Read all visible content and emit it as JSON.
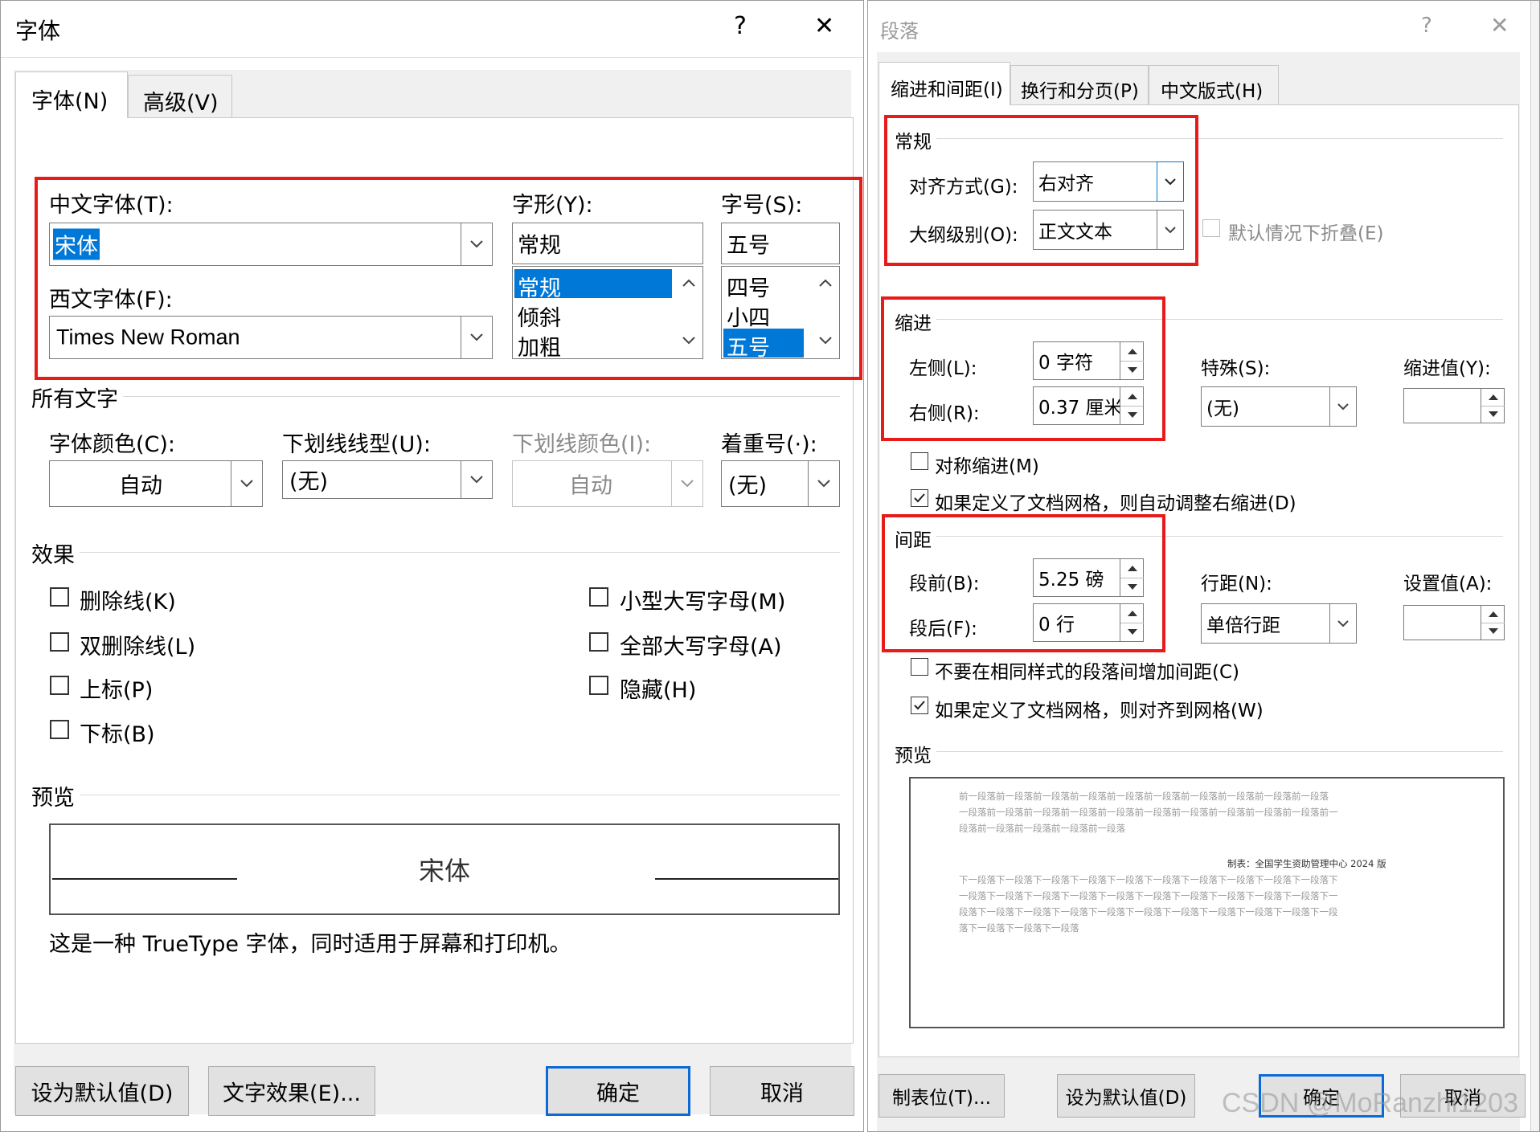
{
  "font_dialog": {
    "title": "字体",
    "help": "?",
    "close": "✕",
    "tabs": [
      "字体(N)",
      "高级(V)"
    ],
    "cn_font": {
      "label": "中文字体(T):",
      "value": "宋体"
    },
    "west_font": {
      "label": "西文字体(F):",
      "value": "Times New Roman"
    },
    "style": {
      "label": "字形(Y):",
      "value": "常规",
      "options": [
        "常规",
        "倾斜",
        "加粗"
      ],
      "selected": "常规"
    },
    "size": {
      "label": "字号(S):",
      "value": "五号",
      "options": [
        "四号",
        "小四",
        "五号"
      ],
      "selected": "五号"
    },
    "all_text": {
      "heading": "所有文字",
      "font_color": {
        "label": "字体颜色(C):",
        "value": "自动"
      },
      "underline_style": {
        "label": "下划线线型(U):",
        "value": "(无)"
      },
      "underline_color": {
        "label": "下划线颜色(I):",
        "value": "自动"
      },
      "emphasis": {
        "label": "着重号(·):",
        "value": "(无)"
      }
    },
    "effects": {
      "heading": "效果",
      "left": [
        "删除线(K)",
        "双删除线(L)",
        "上标(P)",
        "下标(B)"
      ],
      "right": [
        "小型大写字母(M)",
        "全部大写字母(A)",
        "隐藏(H)"
      ]
    },
    "preview": {
      "heading": "预览",
      "sample": "宋体",
      "description": "这是一种 TrueType 字体，同时适用于屏幕和打印机。"
    },
    "buttons": {
      "set_default": "设为默认值(D)",
      "text_effects": "文字效果(E)...",
      "ok": "确定",
      "cancel": "取消"
    }
  },
  "para_dialog": {
    "title": "段落",
    "help": "?",
    "close": "✕",
    "tabs": [
      "缩进和间距(I)",
      "换行和分页(P)",
      "中文版式(H)"
    ],
    "general": {
      "heading": "常规",
      "alignment": {
        "label": "对齐方式(G):",
        "value": "右对齐"
      },
      "outline": {
        "label": "大纲级别(O):",
        "value": "正文文本"
      },
      "collapse": {
        "label": "默认情况下折叠(E)",
        "checked": false
      }
    },
    "indent": {
      "heading": "缩进",
      "left": {
        "label": "左侧(L):",
        "value": "0 字符"
      },
      "right": {
        "label": "右侧(R):",
        "value": "0.37 厘米"
      },
      "special": {
        "label": "特殊(S):",
        "value": "(无)"
      },
      "by": {
        "label": "缩进值(Y):",
        "value": ""
      },
      "mirror": {
        "label": "对称缩进(M)",
        "checked": false
      },
      "auto_adjust": {
        "label": "如果定义了文档网格，则自动调整右缩进(D)",
        "checked": true
      }
    },
    "spacing": {
      "heading": "间距",
      "before": {
        "label": "段前(B):",
        "value": "5.25 磅"
      },
      "after": {
        "label": "段后(F):",
        "value": "0 行"
      },
      "line": {
        "label": "行距(N):",
        "value": "单倍行距"
      },
      "at": {
        "label": "设置值(A):",
        "value": ""
      },
      "no_space_same": {
        "label": "不要在相同样式的段落间增加间距(C)",
        "checked": false
      },
      "snap_grid": {
        "label": "如果定义了文档网格，则对齐到网格(W)",
        "checked": true
      }
    },
    "preview": {
      "heading": "预览",
      "prev_lines": [
        "前一段落前一段落前一段落前一段落前一段落前一段落前一段落前一段落前一段落前一段落",
        "一段落前一段落前一段落前一段落前一段落前一段落前一段落前一段落前一段落前一段落前一",
        "段落前一段落前一段落前一段落前一段落"
      ],
      "current_line": "制表：全国学生资助管理中心 2024 版",
      "next_lines": [
        "下一段落下一段落下一段落下一段落下一段落下一段落下一段落下一段落下一段落下一段落下",
        "一段落下一段落下一段落下一段落下一段落下一段落下一段落下一段落下一段落下一段落下一",
        "段落下一段落下一段落下一段落下一段落下一段落下一段落下一段落下一段落下一段落下一段",
        "落下一段落下一段落下一段落"
      ]
    },
    "buttons": {
      "tabs": "制表位(T)...",
      "set_default": "设为默认值(D)",
      "ok": "确定",
      "cancel": "取消"
    }
  },
  "watermark": "CSDN @MoRanzhi1203",
  "colors": {
    "highlight_box": "#e81b1b",
    "selection": "#0078d7",
    "primary_button_border": "#0b6ad6"
  }
}
